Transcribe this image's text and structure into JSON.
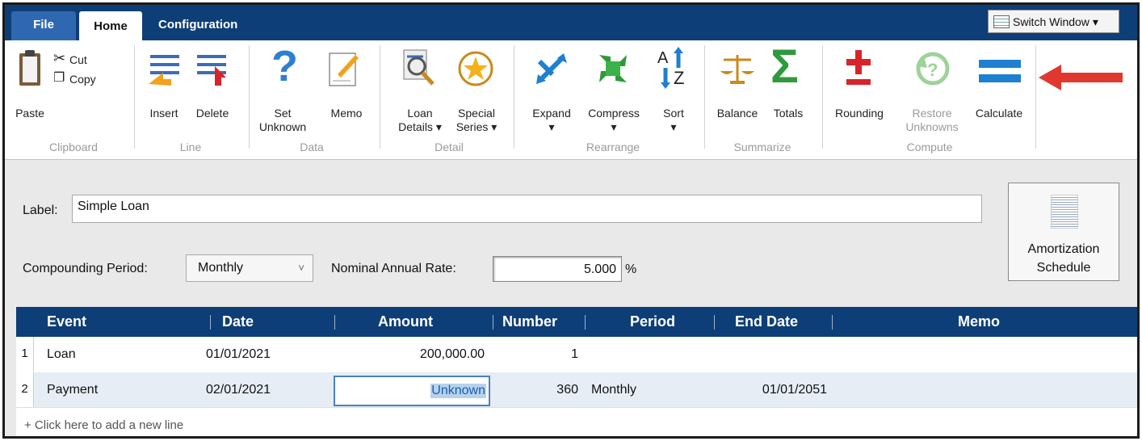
{
  "tabs": {
    "file": "File",
    "home": "Home",
    "configuration": "Configuration"
  },
  "switch_window": "Switch Window",
  "ribbon": {
    "paste": "Paste",
    "cut": "Cut",
    "copy": "Copy",
    "insert": "Insert",
    "delete": "Delete",
    "set_unknown_1": "Set",
    "set_unknown_2": "Unknown",
    "memo": "Memo",
    "loan_details_1": "Loan",
    "loan_details_2": "Details ▾",
    "special_series_1": "Special",
    "special_series_2": "Series ▾",
    "expand": "Expand",
    "compress": "Compress",
    "sort": "Sort",
    "balance": "Balance",
    "totals": "Totals",
    "rounding": "Rounding",
    "restore_1": "Restore",
    "restore_2": "Unknowns",
    "calculate": "Calculate",
    "groups": {
      "clipboard": "Clipboard",
      "line": "Line",
      "data": "Data",
      "detail": "Detail",
      "rearrange": "Rearrange",
      "summarize": "Summarize",
      "compute": "Compute"
    }
  },
  "form": {
    "label_caption": "Label:",
    "label_value": "Simple Loan",
    "compounding_caption": "Compounding Period:",
    "compounding_value": "Monthly",
    "rate_caption": "Nominal Annual Rate:",
    "rate_value": "5.000",
    "rate_unit": "%",
    "amort_1": "Amortization",
    "amort_2": "Schedule"
  },
  "grid": {
    "headers": {
      "event": "Event",
      "date": "Date",
      "amount": "Amount",
      "number": "Number",
      "period": "Period",
      "end_date": "End Date",
      "memo": "Memo"
    },
    "rows": [
      {
        "n": "1",
        "event": "Loan",
        "date": "01/01/2021",
        "amount": "200,000.00",
        "number": "1",
        "period": "",
        "end_date": ""
      },
      {
        "n": "2",
        "event": "Payment",
        "date": "02/01/2021",
        "amount": "Unknown",
        "number": "360",
        "period": "Monthly",
        "end_date": "01/01/2051"
      }
    ],
    "add_line": "+  Click here to add a new line"
  },
  "colors": {
    "title_bar": "#0e3e77",
    "accent": "#2f68b0",
    "arrow": "#e0382f",
    "rounding": "#d8232a",
    "calculate": "#1f7fd0"
  }
}
